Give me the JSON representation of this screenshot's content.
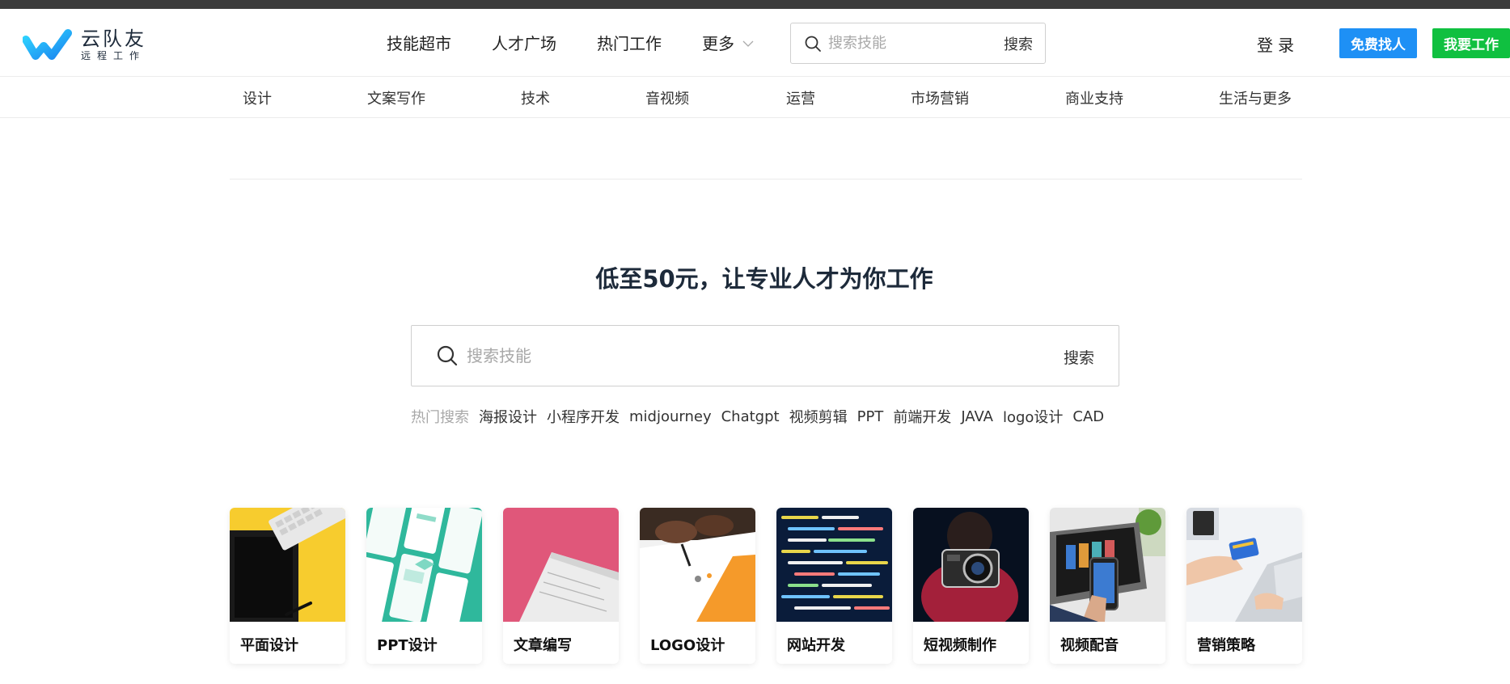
{
  "colors": {
    "brand_blue": "#1e90f5",
    "brand_green": "#10c040",
    "title_text": "#1d2a3a",
    "placeholder": "#a8a8a8"
  },
  "logo": {
    "name": "云队友",
    "sub": "远程工作",
    "icon": "w-logo-icon"
  },
  "nav": {
    "items": [
      {
        "label": "技能超市"
      },
      {
        "label": "人才广场"
      },
      {
        "label": "热门工作"
      }
    ],
    "more_label": "更多"
  },
  "header_search": {
    "placeholder": "搜索技能",
    "button_label": "搜索"
  },
  "auth": {
    "login_label": "登录",
    "hire_label": "免费找人",
    "work_label": "我要工作"
  },
  "categories": [
    "设计",
    "文案写作",
    "技术",
    "音视频",
    "运营",
    "市场营销",
    "商业支持",
    "生活与更多"
  ],
  "hero": {
    "title": "低至50元，让专业人才为你工作",
    "search_placeholder": "搜索技能",
    "search_button": "搜索",
    "hot_label": "热门搜索",
    "hot_tags": [
      "海报设计",
      "小程序开发",
      "midjourney",
      "Chatgpt",
      "视频剪辑",
      "PPT",
      "前端开发",
      "JAVA",
      "logo设计",
      "CAD"
    ]
  },
  "cards": [
    {
      "label": "平面设计"
    },
    {
      "label": "PPT设计"
    },
    {
      "label": "文章编写"
    },
    {
      "label": "LOGO设计"
    },
    {
      "label": "网站开发"
    },
    {
      "label": "短视频制作"
    },
    {
      "label": "视频配音"
    },
    {
      "label": "营销策略"
    }
  ]
}
